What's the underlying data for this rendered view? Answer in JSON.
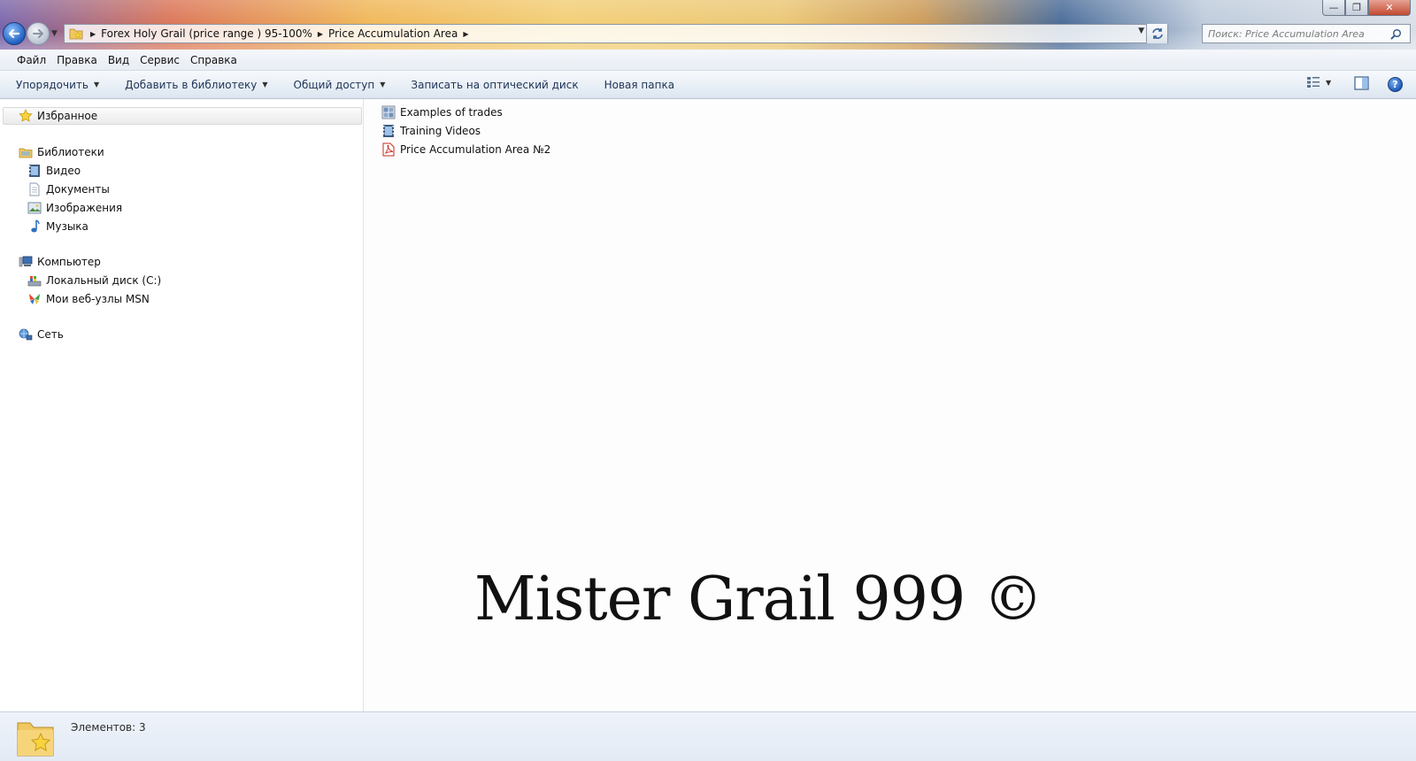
{
  "window": {
    "minimize_glyph": "—",
    "maximize_glyph": "❐",
    "close_glyph": "✕"
  },
  "address": {
    "crumbs": [
      "Forex Holy Grail (price range ) 95-100%",
      "Price Accumulation Area"
    ]
  },
  "search": {
    "placeholder": "Поиск: Price Accumulation Area"
  },
  "menu": {
    "items": [
      "Файл",
      "Правка",
      "Вид",
      "Сервис",
      "Справка"
    ]
  },
  "toolbar": {
    "organize": "Упорядочить",
    "add_to_library": "Добавить в библиотеку",
    "share": "Общий доступ",
    "burn": "Записать на оптический диск",
    "new_folder": "Новая папка",
    "help": "?"
  },
  "nav": {
    "favorites": "Избранное",
    "libraries": "Библиотеки",
    "video": "Видео",
    "documents": "Документы",
    "images": "Изображения",
    "music": "Музыка",
    "computer": "Компьютер",
    "local_disk": "Локальный диск (C:)",
    "msn_sites": "Мои веб-узлы MSN",
    "network": "Сеть"
  },
  "files": [
    {
      "name": "Examples of trades",
      "icon": "image-folder-icon"
    },
    {
      "name": "Training Videos",
      "icon": "video-folder-icon"
    },
    {
      "name": "Price Accumulation Area №2",
      "icon": "pdf-icon"
    }
  ],
  "watermark": "Mister Grail 999 ©",
  "status": {
    "item_count": "Элементов: 3"
  },
  "colors": {
    "command_text": "#1e3356",
    "pdf_red": "#c8281e",
    "help_blue": "#1c5bb8"
  }
}
